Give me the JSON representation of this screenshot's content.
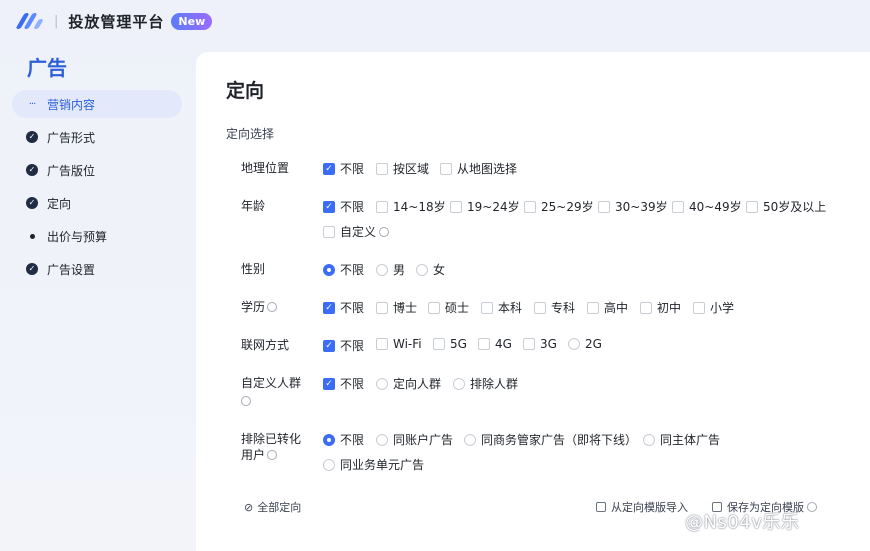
{
  "header": {
    "app_title": "投放管理平台",
    "badge": "New",
    "separator": "|"
  },
  "sidebar": {
    "title": "广告",
    "items": [
      {
        "label": "营销内容",
        "state": "active"
      },
      {
        "label": "广告形式",
        "state": "done"
      },
      {
        "label": "广告版位",
        "state": "done"
      },
      {
        "label": "定向",
        "state": "done"
      },
      {
        "label": "出价与预算",
        "state": "pending"
      },
      {
        "label": "广告设置",
        "state": "done"
      }
    ]
  },
  "main": {
    "title": "定向",
    "section_title": "定向选择",
    "rows": {
      "location": {
        "label": "地理位置",
        "options": [
          "不限",
          "按区域",
          "从地图选择"
        ]
      },
      "age": {
        "label": "年龄",
        "options": [
          "不限",
          "14~18岁",
          "19~24岁",
          "25~29岁",
          "30~39岁",
          "40~49岁",
          "50岁及以上",
          "自定义"
        ]
      },
      "gender": {
        "label": "性别",
        "options": [
          "不限",
          "男",
          "女"
        ]
      },
      "education": {
        "label": "学历",
        "options": [
          "不限",
          "博士",
          "硕士",
          "本科",
          "专科",
          "高中",
          "初中",
          "小学"
        ]
      },
      "network": {
        "label": "联网方式",
        "options": [
          "不限",
          "Wi-Fi",
          "5G",
          "4G",
          "3G",
          "2G"
        ]
      },
      "custom_audience": {
        "label": "自定义人群",
        "options": [
          "不限",
          "定向人群",
          "排除人群"
        ]
      },
      "exclude_converted": {
        "label_line1": "排除已转化",
        "label_line2": "用户",
        "options": [
          "不限",
          "同账户广告",
          "同商务管家广告（即将下线）",
          "同主体广告",
          "同业务单元广告"
        ]
      }
    },
    "footer": {
      "all_targeting": "全部定向",
      "import_template": "从定向模版导入",
      "save_template": "保存为定向模版"
    }
  },
  "watermark": "@Ns04v乐乐",
  "colors": {
    "accent": "#3b6cf6",
    "sidebar_active_bg": "#e3e9fa",
    "title_blue": "#2b5fd9"
  }
}
